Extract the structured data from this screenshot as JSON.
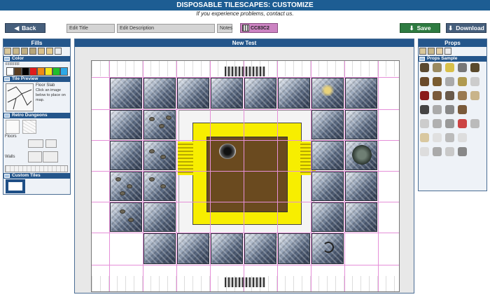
{
  "app": {
    "title": "DISPOSABLE TILESCAPES: CUSTOMIZE",
    "subtitle": "If you experience problems, contact us."
  },
  "toolbar": {
    "back_label": "Back",
    "edit_title_label": "Edit Title",
    "edit_description_label": "Edit Description",
    "notes_label": "Notes",
    "color_code": "CC83C2",
    "save_label": "Save",
    "download_label": "Download"
  },
  "fills": {
    "title": "Fills",
    "color_section": "Color",
    "color_value": "FFFFFF",
    "swatches": [
      "#ffffff",
      "#5a3d20",
      "#000000",
      "#e01b1b",
      "#f08a14",
      "#f5e61a",
      "#1fbf2c",
      "#2da8e6"
    ],
    "tile_preview_section": "Tile Preview",
    "tile_preview_name": "Floor Slab",
    "tile_preview_hint": "Click an image below to place on map.",
    "retro_section": "Retro Dungeons",
    "floors_label": "Floors",
    "walls_label": "Walls",
    "custom_section": "Custom Tiles"
  },
  "map": {
    "title": "New Test"
  },
  "props": {
    "title": "Props",
    "sample_section": "Props Sample"
  }
}
